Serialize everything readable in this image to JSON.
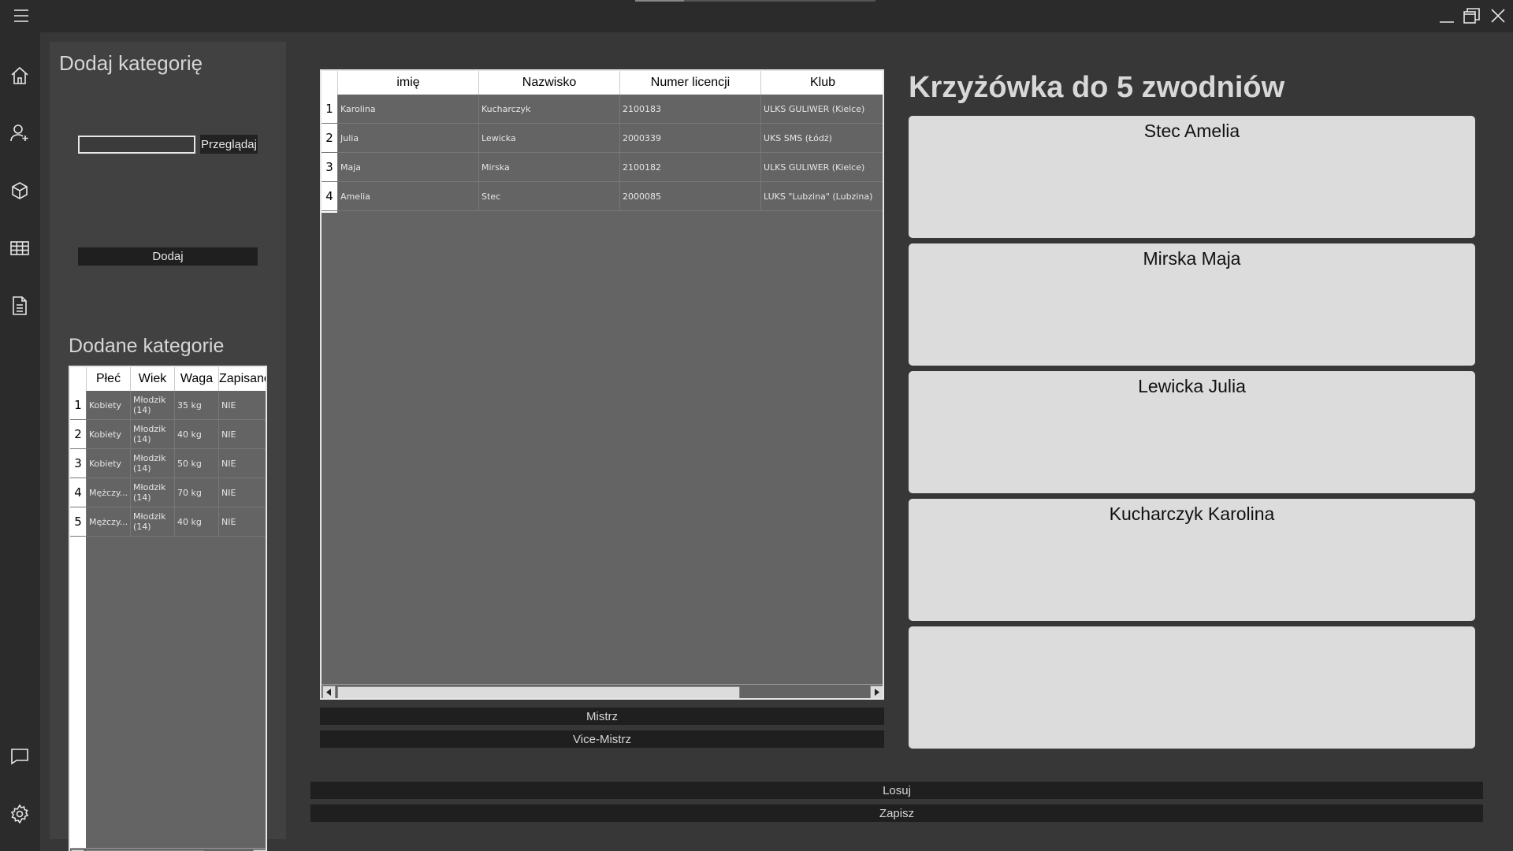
{
  "window": {
    "menu_icon": "hamburger-icon",
    "controls": [
      "minimize-icon",
      "restore-icon",
      "close-icon"
    ]
  },
  "sidebar": {
    "top_icons": [
      "home-icon",
      "add-user-icon",
      "cube-icon",
      "grid-icon",
      "document-icon"
    ],
    "bottom_icons": [
      "chat-icon",
      "gear-icon"
    ]
  },
  "add_category": {
    "title": "Dodaj kategorię",
    "file_value": "",
    "browse_label": "Przeglądaj",
    "add_label": "Dodaj"
  },
  "added_categories": {
    "title": "Dodane kategorie",
    "columns": [
      "Płeć",
      "Wiek",
      "Waga",
      "Zapisano"
    ],
    "rows": [
      {
        "num": "1",
        "sex": "Kobiety",
        "age": "Młodzik (14)",
        "weight": "35 kg",
        "saved": "NIE"
      },
      {
        "num": "2",
        "sex": "Kobiety",
        "age": "Młodzik (14)",
        "weight": "40 kg",
        "saved": "NIE"
      },
      {
        "num": "3",
        "sex": "Kobiety",
        "age": "Młodzik (14)",
        "weight": "50 kg",
        "saved": "NIE"
      },
      {
        "num": "4",
        "sex": "Mężczy...",
        "age": "Młodzik (14)",
        "weight": "70 kg",
        "saved": "NIE"
      },
      {
        "num": "5",
        "sex": "Mężczy...",
        "age": "Młodzik (14)",
        "weight": "40 kg",
        "saved": "NIE"
      }
    ]
  },
  "competitors": {
    "columns": [
      "imię",
      "Nazwisko",
      "Numer licencji",
      "Klub"
    ],
    "rows": [
      {
        "num": "1",
        "first": "Karolina",
        "last": "Kucharczyk",
        "license": "2100183",
        "club": "ULKS GULIWER (Kielce)"
      },
      {
        "num": "2",
        "first": "Julia",
        "last": "Lewicka",
        "license": "2000339",
        "club": "UKS SMS (Łódź)"
      },
      {
        "num": "3",
        "first": "Maja",
        "last": "Mirska",
        "license": "2100182",
        "club": "ULKS GULIWER (Kielce)"
      },
      {
        "num": "4",
        "first": "Amelia",
        "last": "Stec",
        "license": "2000085",
        "club": "LUKS \"Lubzina\" (Lubzina)"
      }
    ]
  },
  "buttons": {
    "champion": "Mistrz",
    "vice_champion": "Vice-Mistrz",
    "draw": "Losuj",
    "save": "Zapisz"
  },
  "bracket": {
    "title": "Krzyżówka do 5 zwodniów",
    "slots": [
      "Stec Amelia",
      "Mirska Maja",
      "Lewicka Julia",
      "Kucharczyk Karolina",
      ""
    ]
  }
}
